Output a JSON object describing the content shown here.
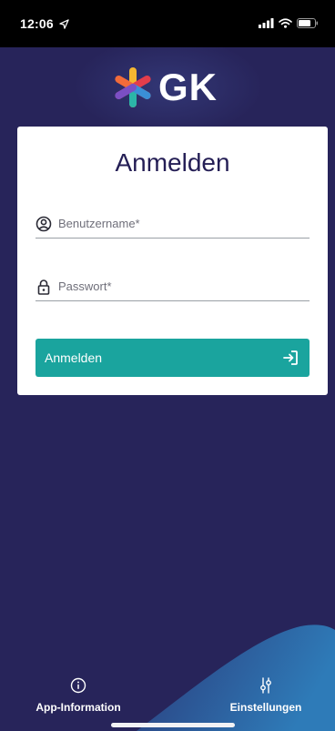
{
  "status_bar": {
    "time": "12:06"
  },
  "logo": {
    "text": "GK",
    "colors": {
      "orange": "#f26b3a",
      "red": "#e33d4b",
      "yellow": "#f5b731",
      "teal": "#2bb5a8",
      "blue": "#3a8fd6",
      "purple": "#7b4fc4"
    }
  },
  "login_card": {
    "title": "Anmelden",
    "username": {
      "placeholder": "Benutzername*",
      "value": ""
    },
    "password": {
      "placeholder": "Passwort*",
      "value": ""
    },
    "submit_label": "Anmelden"
  },
  "bottom_nav": {
    "app_info_label": "App-Information",
    "settings_label": "Einstellungen"
  },
  "colors": {
    "background": "#27245a",
    "accent": "#1aa49e",
    "title": "#241e55",
    "wave": "#2d6aa5"
  }
}
